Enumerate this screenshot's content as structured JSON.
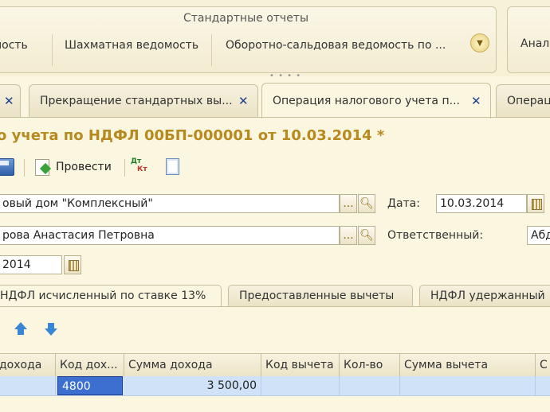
{
  "ribbon": {
    "group_title": "Стандартные отчеты",
    "items": [
      "омость",
      "Шахматная ведомость",
      "Оборотно-сальдовая ведомость по ..."
    ],
    "more_icon": "chevron-down-circle-icon",
    "second_group_item": "Анал"
  },
  "tabs": [
    {
      "label": "",
      "close": "✕"
    },
    {
      "label": "Прекращение стандартных вы...",
      "close": "✕"
    },
    {
      "label": "Операция налогового учета п...",
      "close": "✕"
    },
    {
      "label": "Операц",
      "close": ""
    }
  ],
  "document": {
    "title": "о учета по НДФЛ 00БП-000001 от 10.03.2014 *"
  },
  "toolbar": {
    "post_label": "Провести",
    "dt_label": "Дт",
    "kt_label": "Кт"
  },
  "form": {
    "organization_value": "овый дом \"Комплексный\"",
    "date_label": "Дата:",
    "date_value": "10.03.2014",
    "person_value": "рова Анастасия Петровна",
    "responsible_label": "Ответственный:",
    "responsible_value": "Абд",
    "period_value": "2014",
    "select_button": "...",
    "search_icon": "magnifier-icon"
  },
  "sections": [
    "НДФЛ исчисленный по ставке 13%",
    "Предоставленные вычеты",
    "НДФЛ удержанный"
  ],
  "grid": {
    "columns": [
      "доходa",
      "Код дох...",
      "Сумма дохода",
      "Код вычета",
      "Кол-во",
      "Сумма вычета",
      "С"
    ],
    "rows": [
      [
        "",
        "4800",
        "3 500,00",
        "",
        "",
        "",
        ""
      ]
    ]
  },
  "colors": {
    "title": "#b78a1f",
    "accent": "#3a86d6",
    "selection": "#3d6fd0",
    "row_highlight": "#cfe2f7"
  }
}
